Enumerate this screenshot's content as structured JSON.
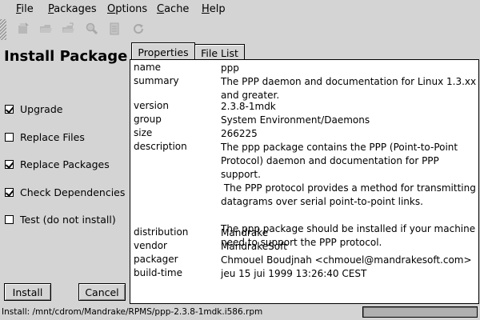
{
  "menu": [
    {
      "label": "File",
      "mnemonic": "F",
      "rest": "ile"
    },
    {
      "label": "Packages",
      "mnemonic": "P",
      "rest": "ackages"
    },
    {
      "label": "Options",
      "mnemonic": "O",
      "rest": "ptions"
    },
    {
      "label": "Cache",
      "mnemonic": "C",
      "rest": "ache"
    },
    {
      "label": "Help",
      "mnemonic": "H",
      "rest": "elp"
    }
  ],
  "toolbar_icons": [
    "install-icon",
    "open-folder-icon",
    "open-folder-alt-icon",
    "search-icon",
    "document-icon",
    "refresh-icon"
  ],
  "left_panel": {
    "title": "Install Package",
    "options": [
      {
        "label": "Upgrade",
        "checked": true
      },
      {
        "label": "Replace Files",
        "checked": false
      },
      {
        "label": "Replace Packages",
        "checked": true
      },
      {
        "label": "Check Dependencies",
        "checked": true
      },
      {
        "label": "Test (do not install)",
        "checked": false
      }
    ],
    "install_label": "Install",
    "cancel_label": "Cancel"
  },
  "tabs": [
    {
      "label": "Properties",
      "active": true
    },
    {
      "label": "File List",
      "active": false
    }
  ],
  "properties": [
    {
      "key": "name",
      "value": "ppp"
    },
    {
      "key": "summary",
      "value": "The PPP daemon and documentation for Linux 1.3.xx\nand greater."
    },
    {
      "key": "version",
      "value": "2.3.8-1mdk"
    },
    {
      "key": "group",
      "value": "System Environment/Daemons"
    },
    {
      "key": "size",
      "value": "266225"
    },
    {
      "key": "description",
      "value": "The ppp package contains the PPP (Point-to-Point\nProtocol) daemon and documentation for PPP support.\n The PPP protocol provides a method for transmitting\ndatagrams over serial point-to-point links.\n\nThe ppp package should be installed if your machine\nneed to support the PPP protocol."
    },
    {
      "key": "distribution",
      "value": "Mandrake"
    },
    {
      "key": "vendor",
      "value": "MandrakeSoft"
    },
    {
      "key": "packager",
      "value": "Chmouel Boudjnah <chmouel@mandrakesoft.com>"
    },
    {
      "key": "build-time",
      "value": "jeu 15 jui 1999 13:26:40 CEST"
    }
  ],
  "status": {
    "text": "Install: /mnt/cdrom/Mandrake/RPMS/ppp-2.3.8-1mdk.i586.rpm",
    "progress": 0
  }
}
